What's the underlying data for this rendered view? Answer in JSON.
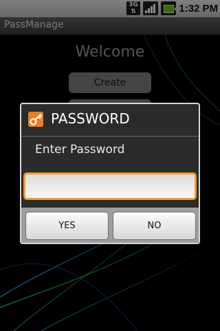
{
  "status_bar": {
    "network_label": "3G",
    "signal_icon": "signal-bars-icon",
    "battery_icon": "battery-charging-icon",
    "time": "1:32 PM"
  },
  "app": {
    "title": "PassManage"
  },
  "main": {
    "welcome": "Welcome",
    "create_label": "Create"
  },
  "dialog": {
    "icon": "key-icon",
    "title": "PASSWORD",
    "message": "Enter Password",
    "input_value": "",
    "yes_label": "YES",
    "no_label": "NO"
  },
  "colors": {
    "accent": "#f39a1e",
    "dialog_bg": "#2b2b2b",
    "button_bar": "#9e9e9e"
  }
}
